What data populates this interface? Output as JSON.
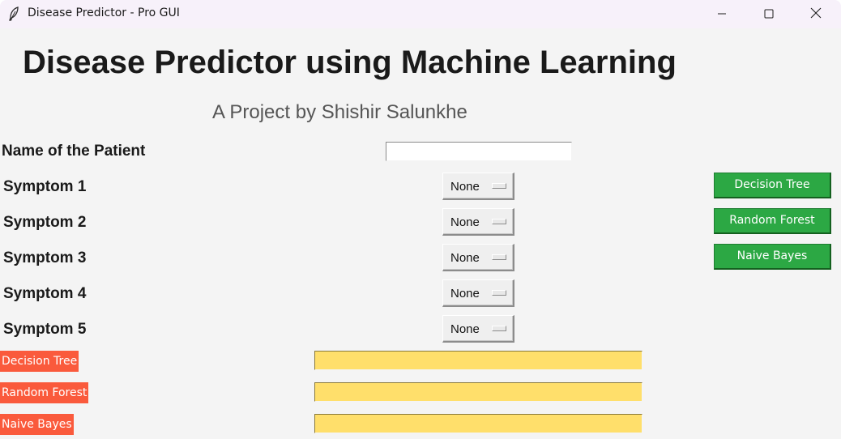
{
  "window": {
    "title": "Disease Predictor - Pro GUI",
    "icon": "feather-icon",
    "controls": [
      "minimize-icon",
      "maximize-icon",
      "close-icon"
    ]
  },
  "header": {
    "title": "Disease Predictor using Machine Learning",
    "subtitle": "A Project by Shishir Salunkhe"
  },
  "form": {
    "name_label": "Name of the Patient",
    "name_value": "",
    "symptoms": [
      {
        "label": "Symptom 1",
        "value": "None"
      },
      {
        "label": "Symptom 2",
        "value": "None"
      },
      {
        "label": "Symptom 3",
        "value": "None"
      },
      {
        "label": "Symptom 4",
        "value": "None"
      },
      {
        "label": "Symptom 5",
        "value": "None"
      }
    ]
  },
  "buttons": {
    "decision_tree": "Decision Tree",
    "random_forest": "Random Forest",
    "naive_bayes": "Naive Bayes"
  },
  "results": [
    {
      "label": "Decision Tree",
      "value": ""
    },
    {
      "label": "Random Forest",
      "value": ""
    },
    {
      "label": "Naive Bayes",
      "value": ""
    }
  ],
  "colors": {
    "button_green": "#2ca844",
    "result_label_red": "#fa5a3c",
    "result_box_yellow": "#ffdf6b",
    "background": "#f4f4f4"
  }
}
